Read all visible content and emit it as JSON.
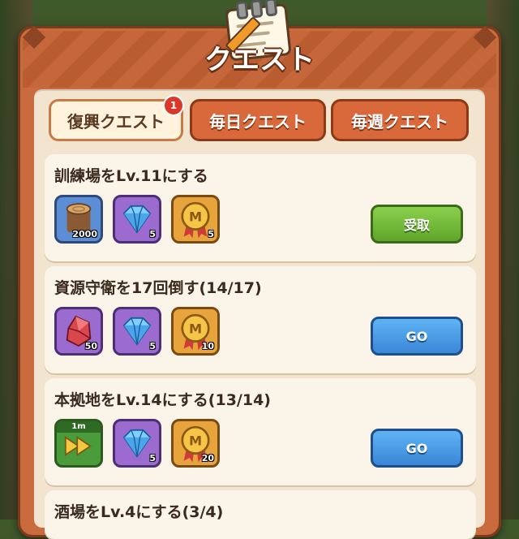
{
  "window": {
    "title": "クエスト"
  },
  "tabs": [
    {
      "label": "復興クエスト",
      "badge": "1",
      "active": true
    },
    {
      "label": "毎日クエスト",
      "active": false
    },
    {
      "label": "毎週クエスト",
      "active": false
    }
  ],
  "quests": [
    {
      "title": "訓練場をLv.11にする",
      "rewards": [
        {
          "icon": "wood-log-icon",
          "count": "2000"
        },
        {
          "icon": "diamond-icon",
          "count": "5"
        },
        {
          "icon": "medal-icon",
          "count": "5"
        }
      ],
      "button": "受取"
    },
    {
      "title": "資源守衛を17回倒す(14/17)",
      "rewards": [
        {
          "icon": "red-crystal-icon",
          "count": "50"
        },
        {
          "icon": "diamond-icon",
          "count": "5"
        },
        {
          "icon": "medal-icon",
          "count": "10"
        }
      ],
      "button": "GO"
    },
    {
      "title": "本拠地をLv.14にする(13/14)",
      "rewards": [
        {
          "icon": "speedup-icon",
          "top_label": "1m"
        },
        {
          "icon": "diamond-icon",
          "count": "5"
        },
        {
          "icon": "medal-icon",
          "count": "20"
        }
      ],
      "button": "GO"
    },
    {
      "title": "酒場をLv.4にする(3/4)"
    }
  ]
}
